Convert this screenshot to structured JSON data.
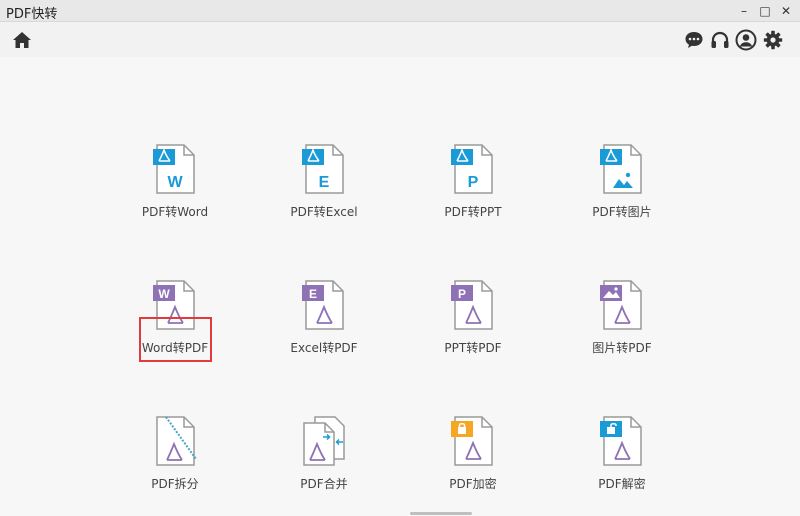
{
  "window": {
    "title": "PDF快转",
    "minimize_glyph": "–",
    "maximize_glyph": "□",
    "close_glyph": "✕"
  },
  "toolbar": {
    "left_icon": "home-icon",
    "right_icons": [
      "chat-icon",
      "headset-icon",
      "user-icon",
      "gear-icon"
    ]
  },
  "colors": {
    "blue": "#1a9bd7",
    "purple": "#8e72b5",
    "orange": "#f5a623",
    "doc_gray": "#9a9a9a",
    "highlight": "#e33b3b"
  },
  "tools": [
    {
      "label": "PDF转Word",
      "badge": "W"
    },
    {
      "label": "PDF转Excel",
      "badge": "E"
    },
    {
      "label": "PDF转PPT",
      "badge": "P"
    },
    {
      "label": "PDF转图片",
      "badge": ""
    },
    {
      "label": "Word转PDF",
      "badge": "W"
    },
    {
      "label": "Excel转PDF",
      "badge": "E"
    },
    {
      "label": "PPT转PDF",
      "badge": "P"
    },
    {
      "label": "图片转PDF",
      "badge": ""
    },
    {
      "label": "PDF拆分",
      "badge": ""
    },
    {
      "label": "PDF合并",
      "badge": ""
    },
    {
      "label": "PDF加密",
      "badge": ""
    },
    {
      "label": "PDF解密",
      "badge": ""
    }
  ]
}
